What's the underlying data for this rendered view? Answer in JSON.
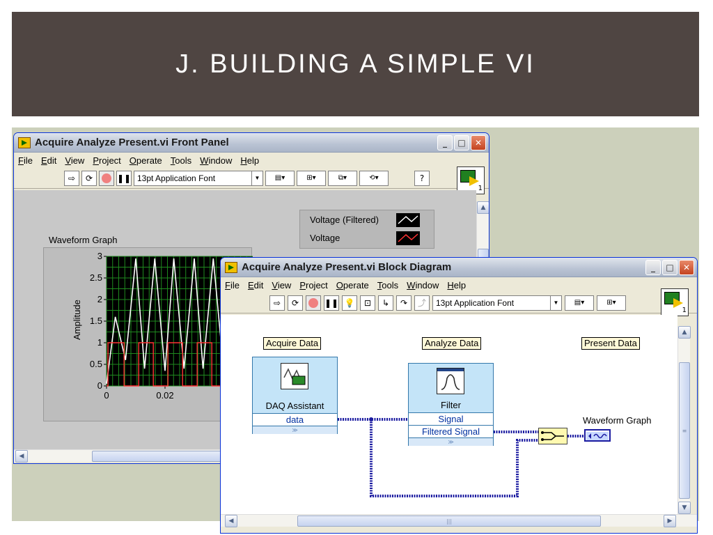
{
  "slide": {
    "title": "J. BUILDING A SIMPLE VI"
  },
  "colors": {
    "banner": "#4f4542",
    "backdrop": "#ccd0bb",
    "graph_bg": "#000000",
    "grid": "#1f8a1f",
    "voltage_filtered": "#ffffff",
    "voltage": "#ff3333",
    "wire": "#1a1aa0"
  },
  "front_panel": {
    "title": "Acquire Analyze Present.vi Front Panel",
    "menu": [
      "File",
      "Edit",
      "View",
      "Project",
      "Operate",
      "Tools",
      "Window",
      "Help"
    ],
    "font_select": "13pt Application Font",
    "help_glyph": "?",
    "corner_num": "1",
    "legend": [
      {
        "label": "Voltage (Filtered)",
        "color": "#ffffff"
      },
      {
        "label": "Voltage",
        "color": "#ff3333"
      }
    ],
    "graph_label": "Waveform Graph",
    "ylabel": "Amplitude",
    "yticks": [
      "3",
      "2.5",
      "2",
      "1.5",
      "1",
      "0.5",
      "0"
    ],
    "xticks": [
      "0",
      "0.02",
      "("
    ]
  },
  "block_diagram": {
    "title": "Acquire Analyze Present.vi Block Diagram",
    "menu": [
      "File",
      "Edit",
      "View",
      "Project",
      "Operate",
      "Tools",
      "Window",
      "Help"
    ],
    "font_select": "13pt Application Font",
    "corner_num": "1",
    "labels": {
      "acquire": "Acquire Data",
      "analyze": "Analyze Data",
      "present": "Present Data"
    },
    "daq": {
      "title": "DAQ Assistant",
      "terminal": "data"
    },
    "filter": {
      "title": "Filter",
      "in_terminal": "Signal",
      "out_terminal": "Filtered Signal"
    },
    "graph_terminal_label": "Waveform Graph",
    "scroll_mark": "|||"
  },
  "chart_data": {
    "type": "line",
    "ylabel": "Amplitude",
    "ylim": [
      0,
      3
    ],
    "xlim": [
      0,
      0.05
    ],
    "grid": true,
    "series": [
      {
        "name": "Voltage (Filtered)",
        "color": "#ffffff",
        "x": [
          0,
          0.003,
          0.0065,
          0.01,
          0.013,
          0.0165,
          0.02,
          0.023,
          0.0265,
          0.03,
          0.033,
          0.0365,
          0.04
        ],
        "y": [
          0.05,
          1.6,
          0.6,
          2.95,
          0.4,
          2.95,
          0.35,
          2.95,
          0.4,
          2.95,
          0.4,
          2.95,
          0.4
        ]
      },
      {
        "name": "Voltage",
        "color": "#ff3333",
        "x": [
          0,
          0.0005,
          0.0005,
          0.0015,
          0.0015,
          0.006,
          0.006,
          0.011,
          0.011,
          0.016,
          0.016,
          0.021,
          0.021,
          0.026,
          0.026,
          0.031,
          0.031,
          0.036,
          0.036,
          0.04
        ],
        "y": [
          0,
          0,
          1,
          1,
          1,
          1,
          0,
          0,
          1,
          1,
          0,
          0,
          1,
          1,
          0,
          0,
          1,
          1,
          0,
          0
        ]
      }
    ]
  }
}
